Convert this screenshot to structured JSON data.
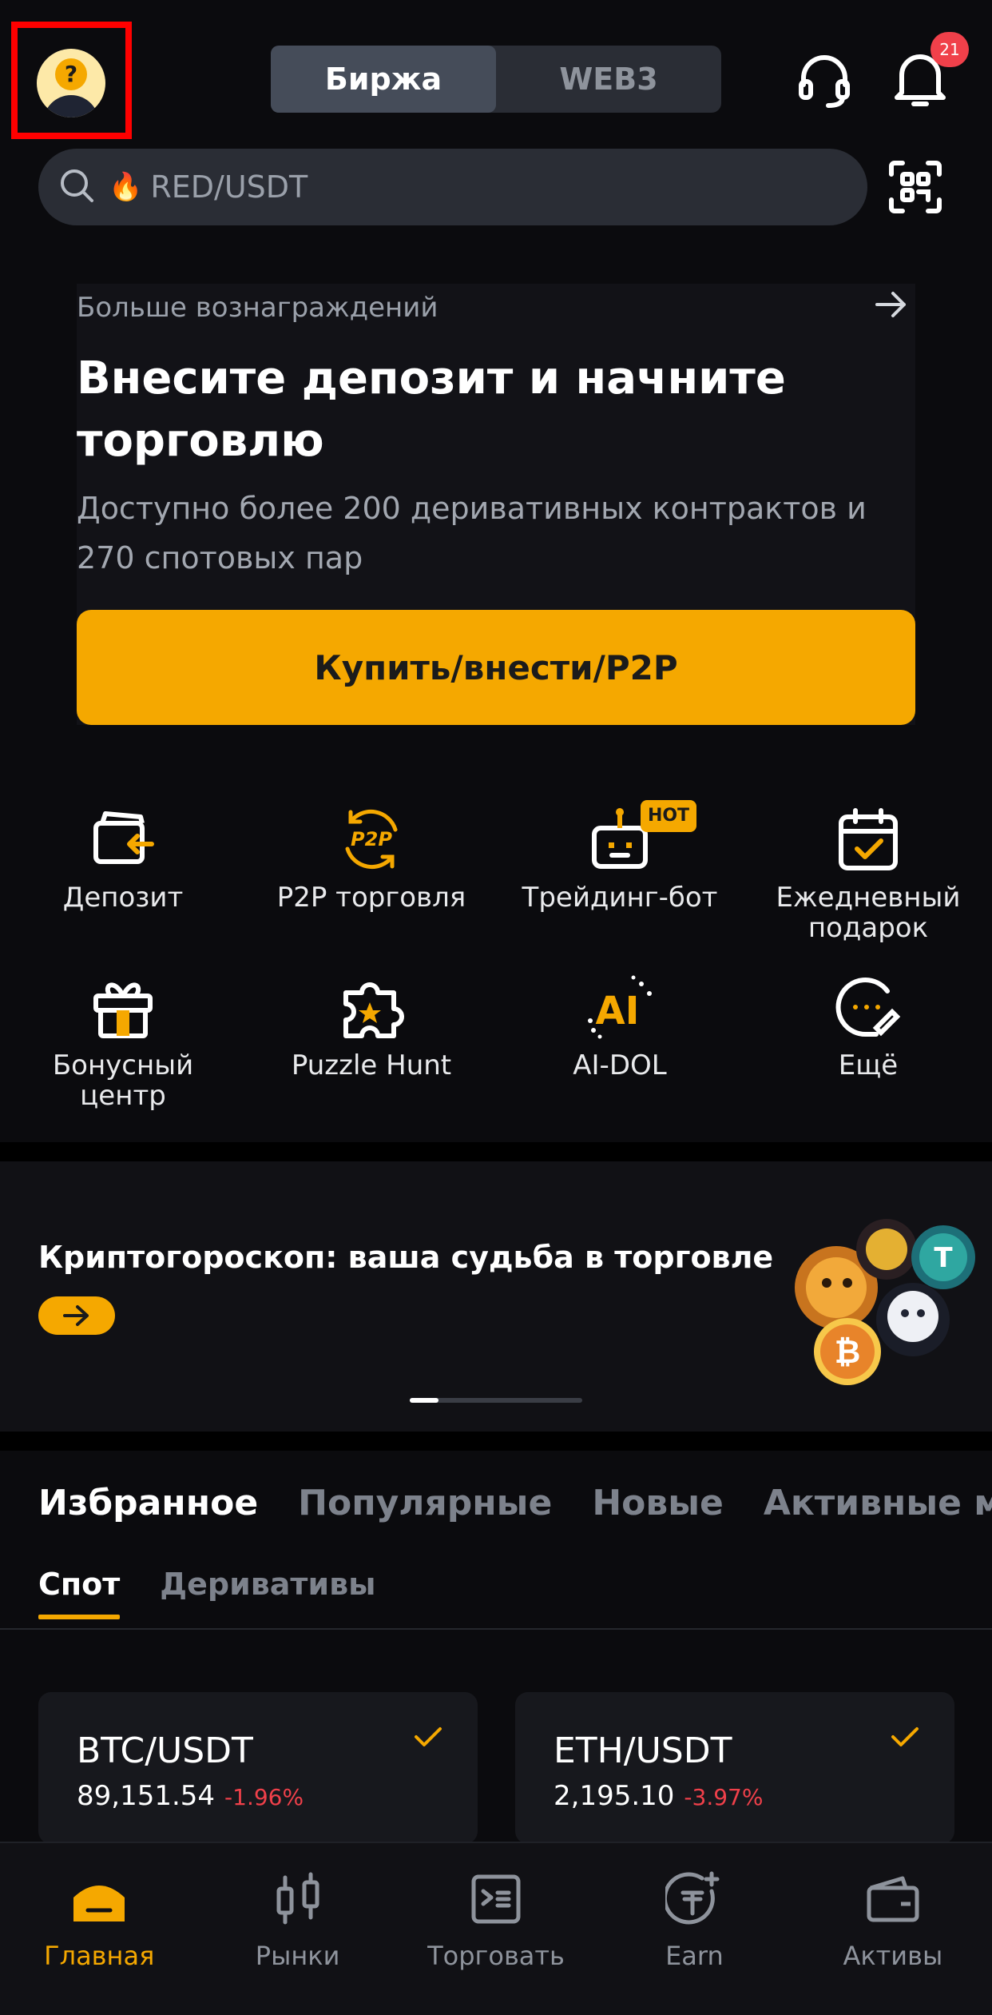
{
  "header": {
    "segment_exchange": "Биржа",
    "segment_web3": "WEB3",
    "notification_count": "21",
    "avatar_glyph": "?"
  },
  "search": {
    "placeholder": "RED/USDT",
    "fire_glyph": "🔥"
  },
  "promo": {
    "kicker": "Больше вознаграждений",
    "title": "Внесите депозит и начните торговлю",
    "description": "Доступно более 200 деривативных контрактов и 270 спотовых пар",
    "cta": "Купить/внести/P2P"
  },
  "quick_actions": [
    {
      "label": "Депозит",
      "icon": "deposit-icon"
    },
    {
      "label": "P2P торговля",
      "icon": "p2p-icon"
    },
    {
      "label": "Трейдинг-бот",
      "icon": "trading-bot-icon"
    },
    {
      "label": "Ежедневный подарок",
      "icon": "calendar-check-icon"
    },
    {
      "label": "Бонусный центр",
      "icon": "gift-icon"
    },
    {
      "label": "Puzzle Hunt",
      "icon": "puzzle-icon"
    },
    {
      "label": "AI-DOL",
      "icon": "ai-icon"
    },
    {
      "label": "Ещё",
      "icon": "more-icon"
    }
  ],
  "hot_badge": "HOT",
  "banner": {
    "title": "Криптогороскоп: ваша судьба в торговле"
  },
  "market_tabs": [
    "Избранное",
    "Популярные",
    "Новые",
    "Активные монеты"
  ],
  "sub_tabs": [
    "Спот",
    "Деривативы"
  ],
  "favorites": [
    {
      "pair": "BTC/USDT",
      "price": "89,151.54",
      "change": "-1.96%"
    },
    {
      "pair": "ETH/USDT",
      "price": "2,195.10",
      "change": "-3.97%"
    }
  ],
  "bottom_nav": [
    {
      "label": "Главная",
      "icon": "home-icon"
    },
    {
      "label": "Рынки",
      "icon": "markets-icon"
    },
    {
      "label": "Торговать",
      "icon": "trade-icon"
    },
    {
      "label": "Earn",
      "icon": "earn-icon"
    },
    {
      "label": "Активы",
      "icon": "wallet-icon"
    }
  ],
  "colors": {
    "accent": "#f5a800",
    "background": "#0b0b0e",
    "negative": "#f0404a",
    "badge": "#f0404a"
  }
}
